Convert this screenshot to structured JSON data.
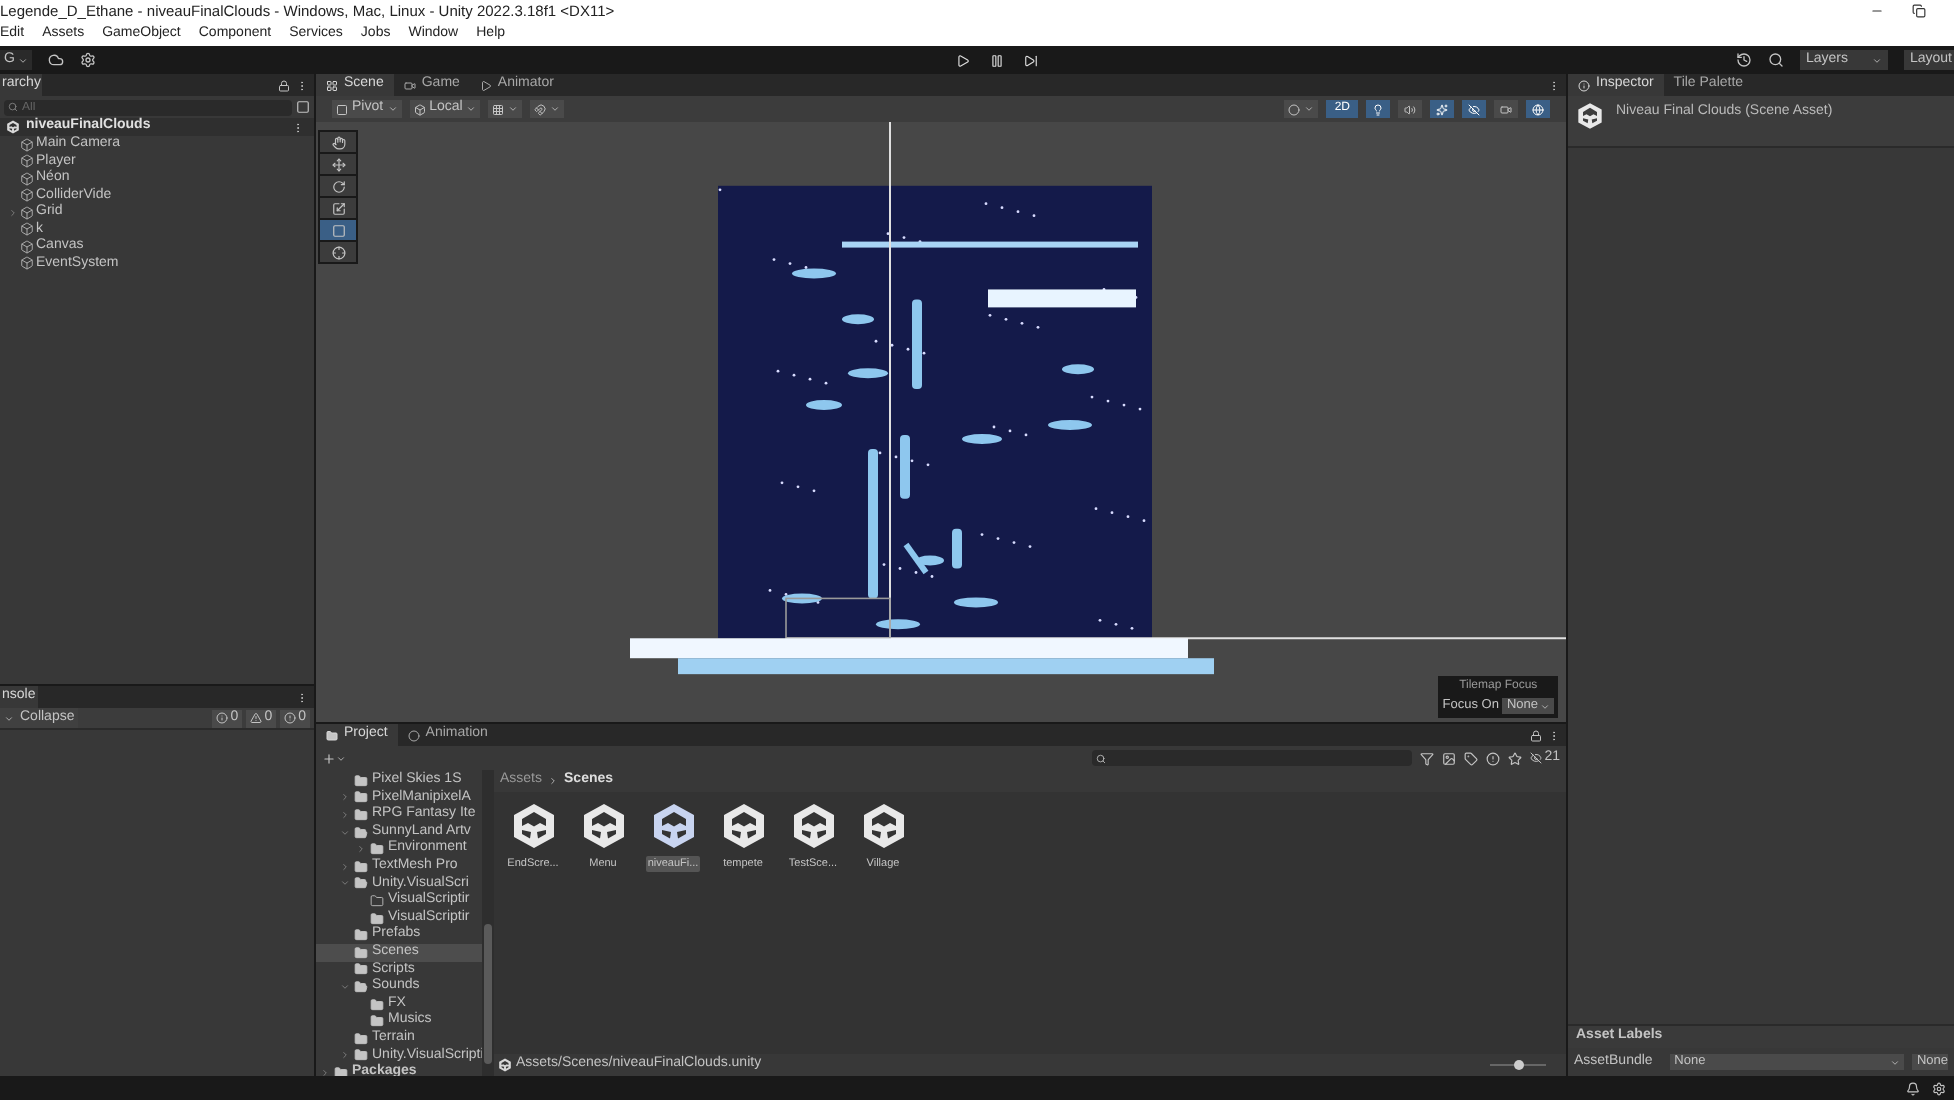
{
  "window": {
    "title": "Legende_D_Ethane - niveauFinalClouds - Windows, Mac, Linux - Unity 2022.3.18f1 <DX11>"
  },
  "menu": [
    "Edit",
    "Assets",
    "GameObject",
    "Component",
    "Services",
    "Jobs",
    "Window",
    "Help"
  ],
  "toolbar": {
    "account": "G",
    "layers": "Layers",
    "layout": "Layout"
  },
  "hierarchy": {
    "tab": "rarchy",
    "search_placeholder": "All",
    "scene": "niveauFinalClouds",
    "items": [
      {
        "label": "Main Camera"
      },
      {
        "label": "Player"
      },
      {
        "label": "Néon"
      },
      {
        "label": "ColliderVide"
      },
      {
        "label": "Grid",
        "expanded": false
      },
      {
        "label": "k"
      },
      {
        "label": "Canvas"
      },
      {
        "label": "EventSystem"
      }
    ]
  },
  "console": {
    "tab": "nsole",
    "collapse": "Collapse",
    "counts": [
      {
        "kind": "info",
        "count": "0"
      },
      {
        "kind": "warning",
        "count": "0"
      },
      {
        "kind": "error",
        "count": "0"
      }
    ]
  },
  "scene_view": {
    "tabs": [
      {
        "label": "Scene",
        "selected": true
      },
      {
        "label": "Game",
        "selected": false
      },
      {
        "label": "Animator",
        "selected": false
      }
    ],
    "pivot": "Pivot",
    "local": "Local",
    "mode_2d": {
      "label": "2D",
      "on": true
    },
    "toggles": [
      {
        "kind": "lighting",
        "on": true
      },
      {
        "kind": "audio",
        "on": false
      },
      {
        "kind": "effects",
        "on": true
      },
      {
        "kind": "visibility",
        "on": true
      },
      {
        "kind": "camera",
        "on": false
      },
      {
        "kind": "gizmos",
        "on": true
      }
    ],
    "tools": [
      {
        "kind": "hand",
        "selected": false
      },
      {
        "kind": "move",
        "selected": false
      },
      {
        "kind": "rotate",
        "selected": false
      },
      {
        "kind": "scale",
        "selected": false
      },
      {
        "kind": "rect",
        "selected": true
      },
      {
        "kind": "transform",
        "selected": false
      }
    ],
    "tilemap_focus": {
      "title": "Tilemap Focus",
      "label": "Focus On",
      "value": "None"
    }
  },
  "project": {
    "tabs": [
      {
        "label": "Project",
        "selected": true
      },
      {
        "label": "Animation",
        "selected": false
      }
    ],
    "tree": [
      {
        "label": "Pixel Skies 1S",
        "kind": "folder",
        "selected": false
      },
      {
        "label": "PixelManipixelA",
        "kind": "folder",
        "selected": false,
        "expanded": false
      },
      {
        "label": "RPG Fantasy Ite",
        "kind": "folder",
        "selected": false,
        "expanded": false
      },
      {
        "label": "SunnyLand Artv",
        "kind": "folder",
        "selected": false,
        "expanded": true,
        "children": [
          {
            "label": "Environment",
            "kind": "folder",
            "selected": false,
            "expanded": false
          }
        ]
      },
      {
        "label": "TextMesh Pro",
        "kind": "folder",
        "selected": false,
        "expanded": false
      },
      {
        "label": "Unity.VisualScri",
        "kind": "folder",
        "selected": false,
        "expanded": true,
        "children": [
          {
            "label": "VisualScriptir",
            "kind": "empty-folder",
            "selected": false
          },
          {
            "label": "VisualScriptir",
            "kind": "folder",
            "selected": false
          }
        ]
      },
      {
        "label": "Prefabs",
        "kind": "folder",
        "selected": false
      },
      {
        "label": "Scenes",
        "kind": "folder",
        "selected": true
      },
      {
        "label": "Scripts",
        "kind": "folder",
        "selected": false
      },
      {
        "label": "Sounds",
        "kind": "folder",
        "selected": false,
        "expanded": true,
        "children": [
          {
            "label": "FX",
            "kind": "folder",
            "selected": false
          },
          {
            "label": "Musics",
            "kind": "folder",
            "selected": false
          }
        ]
      },
      {
        "label": "Terrain",
        "kind": "folder",
        "selected": false
      },
      {
        "label": "Unity.VisualScripti",
        "kind": "folder",
        "selected": false,
        "expanded": false
      },
      {
        "label": "Packages",
        "kind": "root",
        "selected": false,
        "expanded": false
      }
    ],
    "filter_count": "21",
    "breadcrumb": [
      "Assets",
      "Scenes"
    ],
    "assets": [
      {
        "label": "EndScre...",
        "selected": false
      },
      {
        "label": "Menu",
        "selected": false
      },
      {
        "label": "niveauFi...",
        "selected": true
      },
      {
        "label": "tempete",
        "selected": false
      },
      {
        "label": "TestSce...",
        "selected": false
      },
      {
        "label": "Village",
        "selected": false
      }
    ],
    "path": "Assets/Scenes/niveauFinalClouds.unity",
    "zoom": {
      "level": 0.5
    }
  },
  "inspector": {
    "tabs": [
      {
        "label": "Inspector",
        "selected": true
      },
      {
        "label": "Tile Palette",
        "selected": false
      }
    ],
    "title": "Niveau Final Clouds (Scene Asset)",
    "asset_labels": "Asset Labels",
    "asset_bundle": {
      "label": "AssetBundle",
      "value": "None",
      "variant": "None"
    }
  }
}
